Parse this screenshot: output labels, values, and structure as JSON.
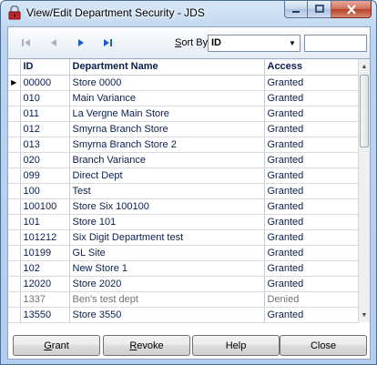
{
  "window": {
    "title": "View/Edit Department Security - JDS"
  },
  "toolbar": {
    "nav_first_icon": "first-record-icon",
    "nav_prev_icon": "previous-record-icon",
    "nav_next_icon": "next-record-icon",
    "nav_last_icon": "last-record-icon",
    "sort_by_label_key": "S",
    "sort_by_label_rest": "ort By",
    "sort_by_value": "ID",
    "search_value": ""
  },
  "table": {
    "columns": [
      "ID",
      "Department Name",
      "Access"
    ],
    "rows": [
      {
        "id": "00000",
        "name": "Store 0000",
        "access": "Granted",
        "current": true
      },
      {
        "id": "010",
        "name": "Main Variance",
        "access": "Granted"
      },
      {
        "id": "011",
        "name": "La Vergne Main Store",
        "access": "Granted"
      },
      {
        "id": "012",
        "name": "Smyrna Branch Store",
        "access": "Granted"
      },
      {
        "id": "013",
        "name": "Smyrna Branch Store 2",
        "access": "Granted"
      },
      {
        "id": "020",
        "name": "Branch Variance",
        "access": "Granted"
      },
      {
        "id": "099",
        "name": "Direct Dept",
        "access": "Granted"
      },
      {
        "id": "100",
        "name": "Test",
        "access": "Granted"
      },
      {
        "id": "100100",
        "name": "Store Six 100100",
        "access": "Granted"
      },
      {
        "id": "101",
        "name": "Store 101",
        "access": "Granted"
      },
      {
        "id": "101212",
        "name": "Six Digit Department test",
        "access": "Granted"
      },
      {
        "id": "10199",
        "name": "GL Site",
        "access": "Granted"
      },
      {
        "id": "102",
        "name": "New Store 1",
        "access": "Granted"
      },
      {
        "id": "12020",
        "name": "Store 2020",
        "access": "Granted"
      },
      {
        "id": "1337",
        "name": "Ben's test dept",
        "access": "Denied"
      },
      {
        "id": "13550",
        "name": "Store 3550",
        "access": "Granted"
      }
    ]
  },
  "buttons": {
    "grant_key": "G",
    "grant_rest": "rant",
    "revoke_key": "R",
    "revoke_rest": "evoke",
    "help": "Help",
    "close": "Close"
  },
  "colors": {
    "text": "#0a1e4a",
    "denied_text": "#6e7277",
    "nav_active": "#1e5cc8",
    "nav_disabled": "#a9b4c3"
  }
}
